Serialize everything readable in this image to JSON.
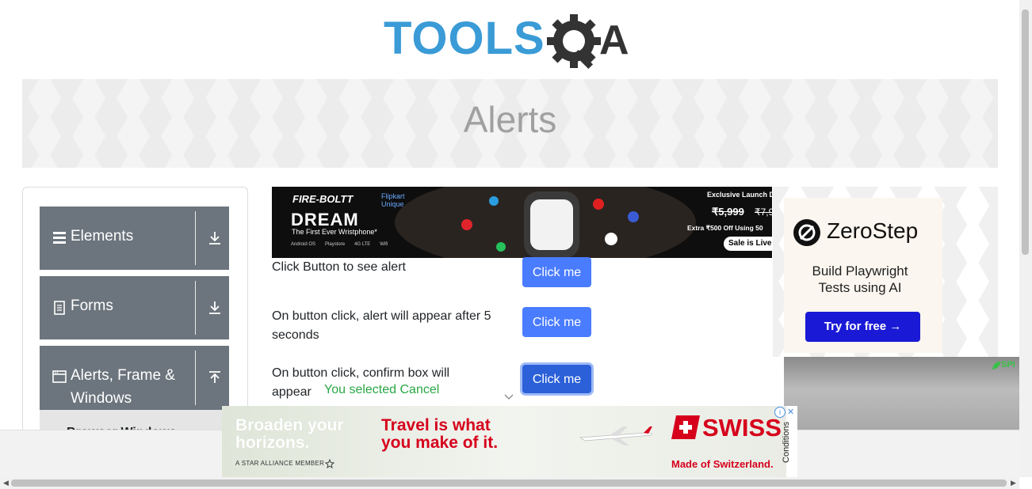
{
  "header": {
    "logo_text_tools": "TOOLS",
    "logo_text_qa": "QA"
  },
  "banner": {
    "title": "Alerts"
  },
  "left_menu": {
    "groups": [
      {
        "label": "Elements",
        "icon": "hamburger-icon",
        "arrow": "download-arrow-icon"
      },
      {
        "label": "Forms",
        "icon": "document-icon",
        "arrow": "download-arrow-icon"
      },
      {
        "label": "Alerts, Frame & Windows",
        "label_line1": "Alerts, Frame &",
        "label_line2": "Windows",
        "icon": "window-icon",
        "arrow": "upload-arrow-icon"
      }
    ],
    "submenu_first_item": "Browser Windows"
  },
  "ads": {
    "top": {
      "brand": "FIRE-BOLTT",
      "partner": "Flipkart Unique",
      "headline": "DREAM",
      "subline": "The First Ever Wristphone*",
      "launch": "Exclusive Launch Day",
      "price_now": "₹5,999",
      "price_old": "₹7,9",
      "offer": "Extra ₹500 Off Using 50",
      "cta": "Sale is Live",
      "features": [
        "Android OS",
        "Playstore",
        "4G LTE",
        "Wifi"
      ]
    },
    "right": {
      "brand": "ZeroStep",
      "tagline_line1": "Build Playwright",
      "tagline_line2": "Tests using AI",
      "cta": "Try for free →"
    },
    "video_label": "SPI",
    "bottom": {
      "left_line1": "Broaden your",
      "left_line2": "horizons.",
      "left_sub": "A STAR ALLIANCE MEMBER",
      "mid_line1": "Travel is what",
      "mid_line2": "you make of it.",
      "brand": "SWISS",
      "brand_sub": "Made of Switzerland.",
      "conditions": "Conditions",
      "info": "i",
      "close": "✕"
    }
  },
  "alerts": {
    "rows": [
      {
        "label": "Click Button to see alert",
        "button": "Click me"
      },
      {
        "label_line1": "On button click, alert will appear after 5",
        "label_line2": "seconds",
        "button": "Click me"
      },
      {
        "label_line1": "On button click, confirm box will",
        "label_line2": "appear",
        "button": "Click me"
      }
    ],
    "confirm_result": "You selected Cancel"
  },
  "colors": {
    "primary_button": "#4a7cff",
    "menu_group": "#6c757d",
    "result_text": "#28a745",
    "swiss_red": "#d6001c",
    "zerostep_button": "#1a1ad6"
  }
}
